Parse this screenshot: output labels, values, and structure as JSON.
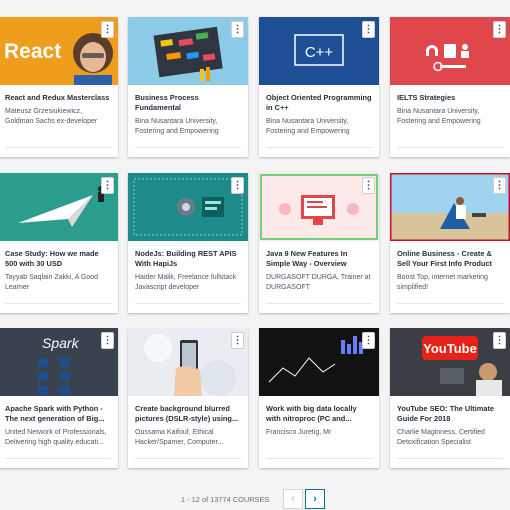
{
  "courses": [
    {
      "title": "React and Redux Masterclass",
      "author": "Mateusz Grzesiukiewicz, Goldman Sachs ex-developer",
      "thumb_text": "React"
    },
    {
      "title": "Business Process Fundamental",
      "author": "Bina Nusantara University, Fostering and Empowering"
    },
    {
      "title": "Object Oriented Programming in C++",
      "author": "Bina Nusantara University, Fostering and Empowering",
      "thumb_text": "C++"
    },
    {
      "title": "IELTS Strategies",
      "author": "Bina Nusantara University, Fostering and Empowering"
    },
    {
      "title": "Case Study: How we made 500 with 30 USD",
      "author": "Tayyab Saqlain Zakki, A Good Learner"
    },
    {
      "title": "NodeJs: Building REST APIS With HapiJs",
      "author": "Haider Malik, Freelance fullstack Javascript developer"
    },
    {
      "title": "Java 9 New Features In Simple Way - Overview",
      "author": "DURGASOFT DURGA, Trainer at DURGASOFT"
    },
    {
      "title": "Online Business - Create & Sell Your First Info Product",
      "author": "Boost Top, internet marketing simplified!"
    },
    {
      "title": "Apache Spark with Python - The next generation of Big...",
      "author": "United Network of Professionals, Delivering high quality educati...",
      "thumb_text": "Spark"
    },
    {
      "title": "Create background blurred pictures (DSLR-style) using...",
      "author": "Oussama Kaifouf, Ethical Hacker/Spamer, Computer..."
    },
    {
      "title": "Work with big data locally with nitroproc (PC and...",
      "author": "Francisco Juretig, Mr"
    },
    {
      "title": "YouTube SEO: The Ultimate Guide For 2018",
      "author": "Charlie Maginness, Certified Detoxification Specialist",
      "thumb_text": "YouTube"
    }
  ],
  "pagination": {
    "summary": "1 - 12 of 13774 COURSES",
    "prev": "‹",
    "next": "›"
  },
  "more_glyph": "⋮",
  "accent": "#007791"
}
